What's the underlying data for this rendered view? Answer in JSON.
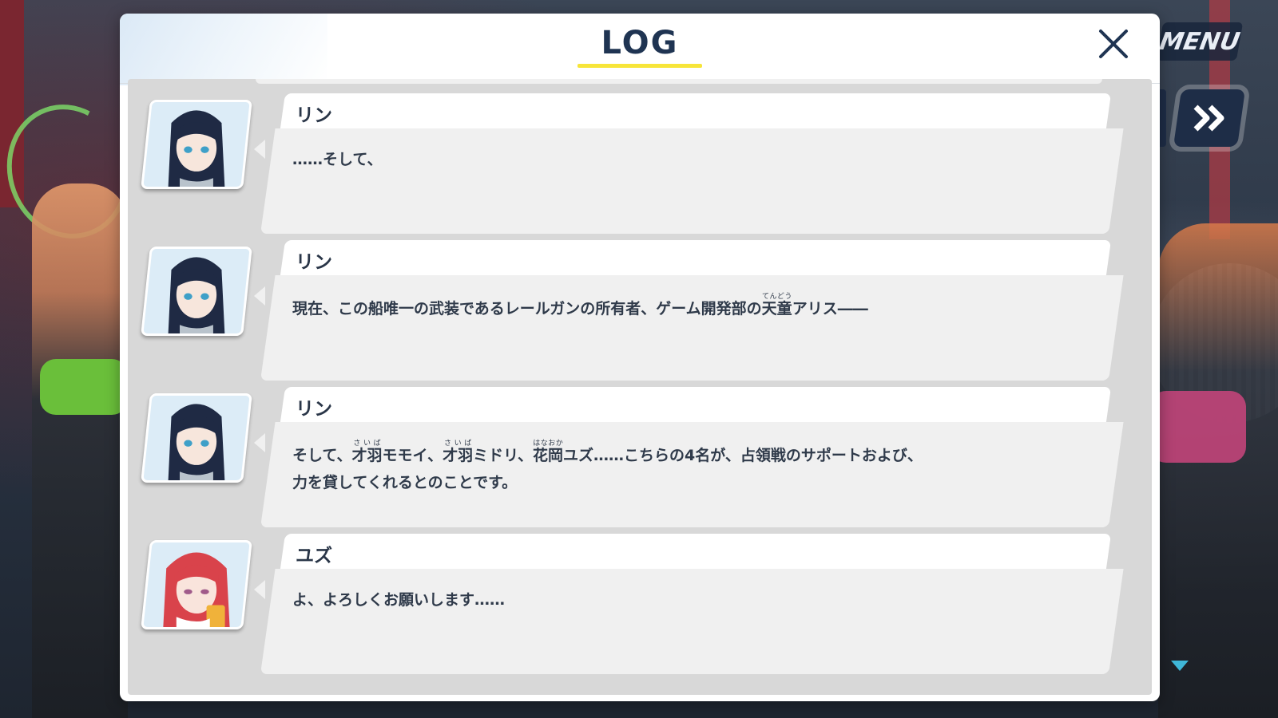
{
  "hud": {
    "menu_label": "MENU",
    "fast_forward_icon": "double-chevron-right-icon",
    "scroll_indicator_icon": "triangle-down-icon"
  },
  "panel": {
    "title": "LOG",
    "close_icon": "close-icon"
  },
  "entries": [
    {
      "speaker": "リン",
      "portrait": "rin-portrait",
      "segments": [
        {
          "text": "……そして、"
        }
      ]
    },
    {
      "speaker": "リン",
      "portrait": "rin-portrait",
      "segments": [
        {
          "text": "現在、この船唯一の武装であるレールガンの所有者、ゲーム開発部の"
        },
        {
          "text": "天童",
          "ruby": "てんどう"
        },
        {
          "text": "アリス――"
        }
      ]
    },
    {
      "speaker": "リン",
      "portrait": "rin-portrait",
      "segments": [
        {
          "text": "そして、"
        },
        {
          "text": "才羽",
          "ruby": "さいば"
        },
        {
          "text": "モモイ、"
        },
        {
          "text": "才羽",
          "ruby": "さいば"
        },
        {
          "text": "ミドリ、"
        },
        {
          "text": "花岡",
          "ruby": "はなおか"
        },
        {
          "text": "ユズ……こちらの4名が、占領戦のサポートおよび、\n力を貸してくれるとのことです。"
        }
      ]
    },
    {
      "speaker": "ユズ",
      "portrait": "yuzu-portrait",
      "segments": [
        {
          "text": "よ、よろしくお願いします……"
        }
      ]
    }
  ],
  "colors": {
    "title": "#1f3452",
    "title_underline": "#f7e539",
    "log_background": "#d8d8d8",
    "bubble_body": "#f0f0f0",
    "text": "#2f3a4a",
    "accent_blue": "#3fb7d8"
  }
}
